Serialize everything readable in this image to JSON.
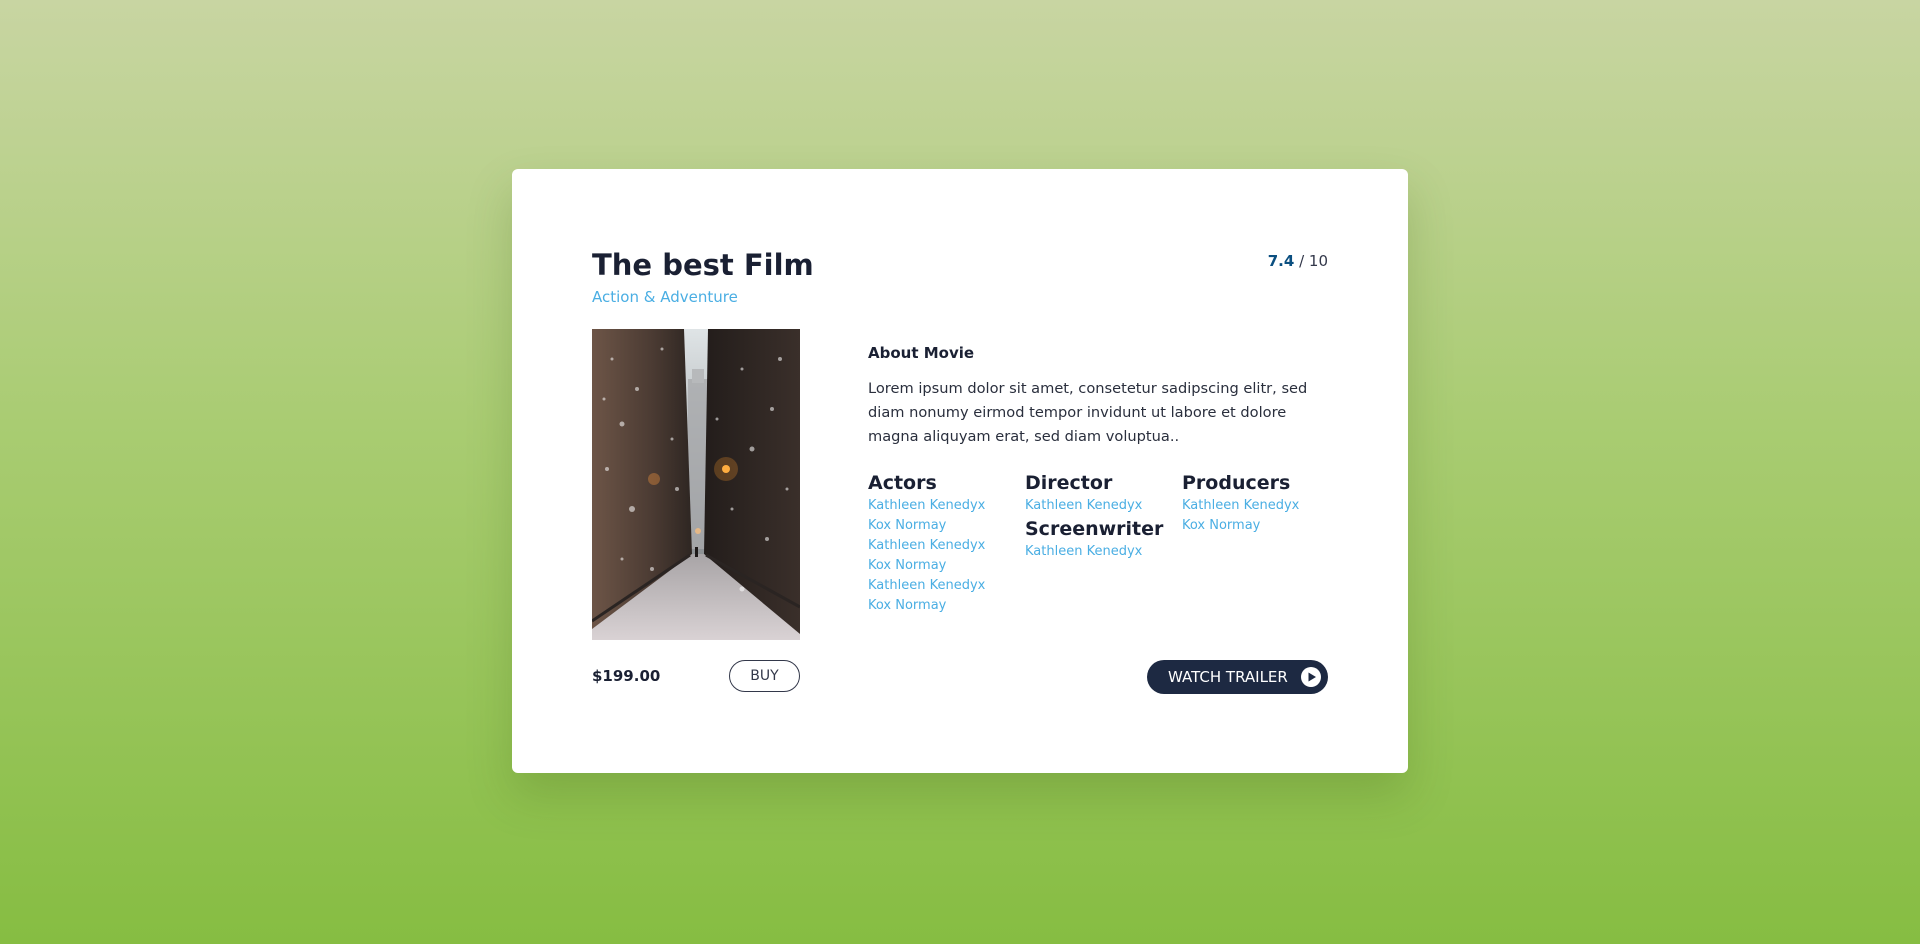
{
  "movie": {
    "title": "The best Film",
    "genre": "Action & Adventure",
    "rating_score": "7.4",
    "rating_max": "/ 10",
    "poster_icon": "city-alley-snow-image",
    "price": "$199.00",
    "buy_label": "BUY",
    "watch_trailer_label": "WATCH TRAILER",
    "watch_trailer_icon": "play-circle-icon"
  },
  "about": {
    "heading": "About Movie",
    "text": "Lorem ipsum dolor sit amet, consetetur sadipscing elitr, sed diam nonumy eirmod tempor invidunt ut labore et dolore magna aliquyam erat, sed diam voluptua.."
  },
  "credits": {
    "actors": {
      "heading": "Actors",
      "names": [
        "Kathleen Kenedyx",
        "Kox Normay",
        "Kathleen Kenedyx",
        "Kox Normay",
        "Kathleen Kenedyx",
        "Kox Normay"
      ]
    },
    "director": {
      "heading": "Director",
      "names": [
        "Kathleen Kenedyx"
      ]
    },
    "screenwriter": {
      "heading": "Screenwriter",
      "names": [
        "Kathleen Kenedyx"
      ]
    },
    "producers": {
      "heading": "Producers",
      "names": [
        "Kathleen Kenedyx",
        "Kox Normay"
      ]
    }
  },
  "colors": {
    "background_top": "#c8d5a2",
    "background_bottom": "#86bd42",
    "accent_blue": "#4aaee3",
    "rating_blue": "#0b4f80",
    "dark_navy": "#1d2942",
    "text_dark": "#1a2033"
  }
}
